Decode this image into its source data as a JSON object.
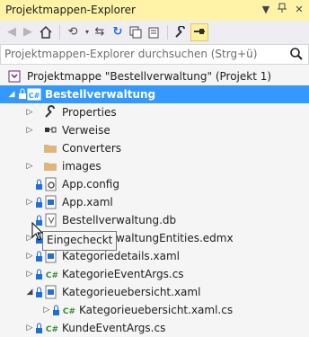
{
  "window": {
    "title": "Projektmappen-Explorer"
  },
  "search": {
    "placeholder": "Projektmappen-Explorer durchsuchen (Strg+ü)"
  },
  "tree": {
    "solution": "Projektmappe \"Bestellverwaltung\" (Projekt 1)",
    "project": "Bestellverwaltung",
    "items": [
      "Properties",
      "Verweise",
      "Converters",
      "images",
      "App.config",
      "App.xaml",
      "Bestellverwaltung.db",
      "BestellverwaltungEntities.edmx",
      "Kategoriedetails.xaml",
      "KategorieEventArgs.cs",
      "Kategorieuebersicht.xaml",
      "Kategorieuebersicht.xaml.cs",
      "KundeEventArgs.cs"
    ]
  },
  "tooltip": "Eingecheckt",
  "colors": {
    "title_bg": "#fff3a8",
    "selection": "#3399ff",
    "csharp": "#388a34",
    "folder": "#dcb67a"
  }
}
